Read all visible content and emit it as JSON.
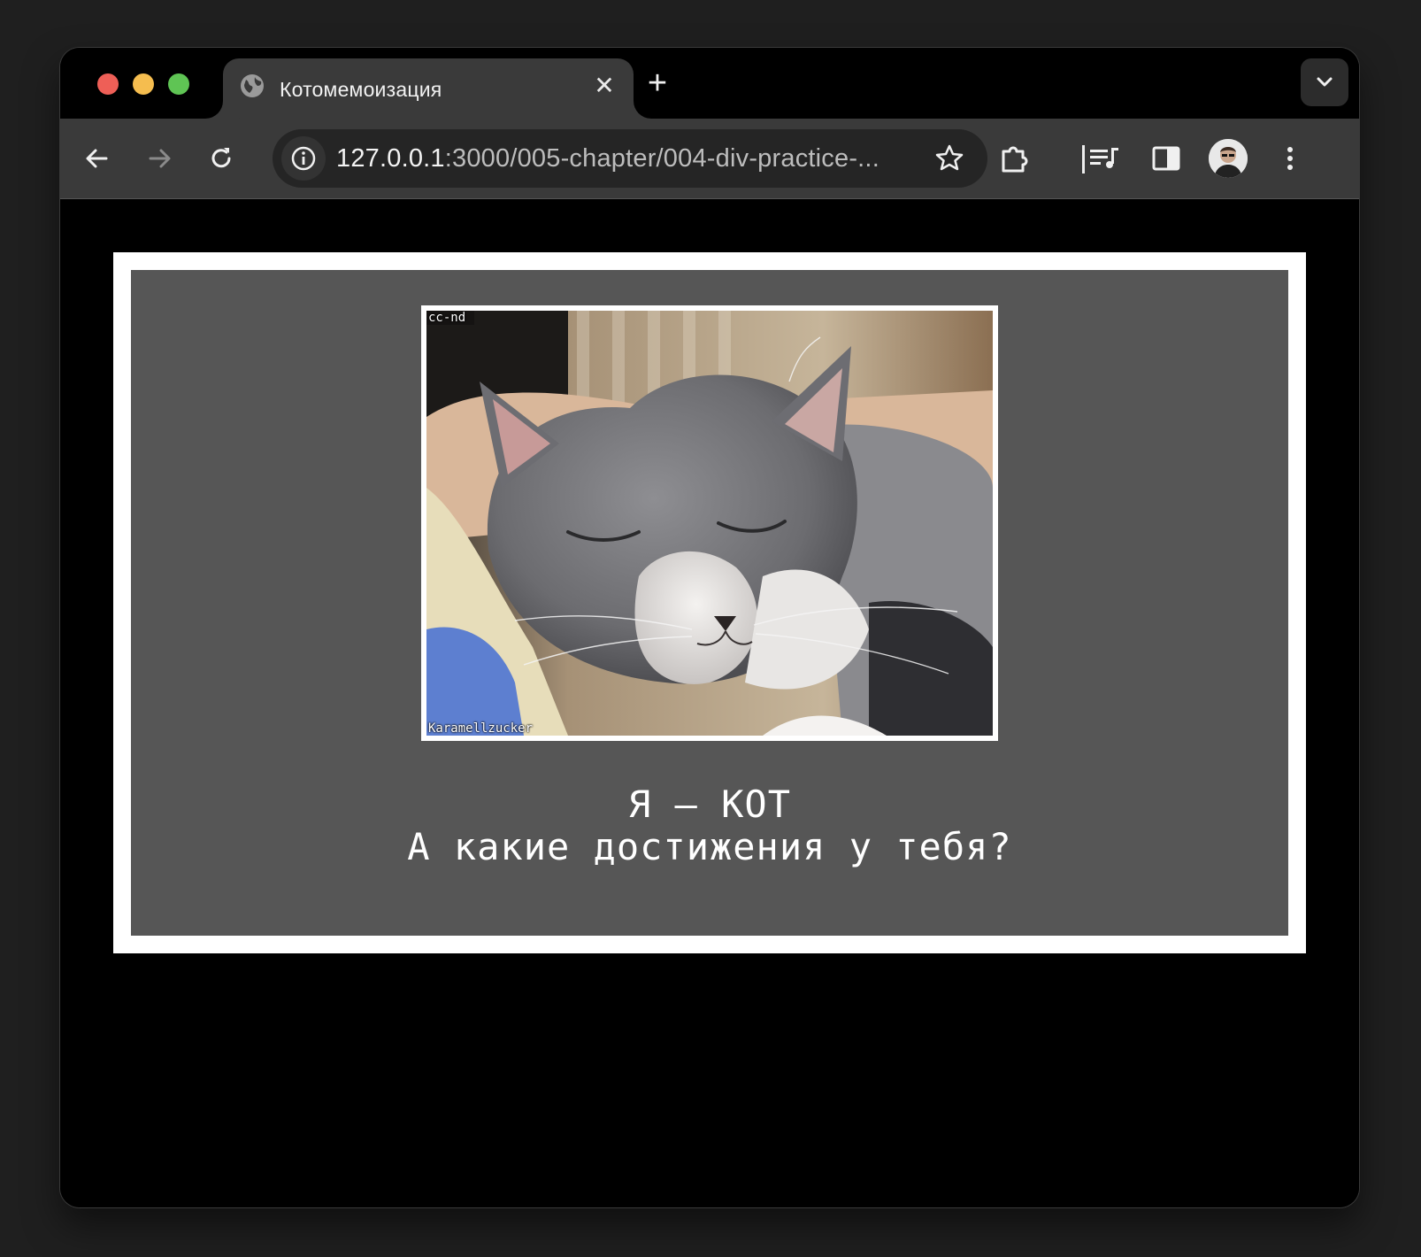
{
  "browser": {
    "tab_title": "Котомемоизация",
    "tab_close": "✕",
    "new_tab": "+",
    "url_host": "127.0.0.1",
    "url_rest": ":3000/005-chapter/004-div-practice-..."
  },
  "icons": {
    "globe": "globe-icon",
    "back": "arrow-left-icon",
    "forward": "arrow-right-icon",
    "reload": "reload-icon",
    "site_info": "info-icon",
    "bookmark": "star-icon",
    "extensions": "puzzle-icon",
    "media": "playlist-icon",
    "side_panel": "side-panel-icon",
    "menu": "kebab-menu-icon",
    "tab_search": "chevron-down-icon"
  },
  "page": {
    "photo_watermark_top": "cc-nd",
    "photo_watermark_bottom": "Karamellzucker",
    "caption_line1": "Я — КОТ",
    "caption_line2": "А какие достижения у тебя?"
  },
  "colors": {
    "page_background": "#000000",
    "frame": "#ffffff",
    "card": "#565656",
    "caption_text": "#ffffff"
  }
}
